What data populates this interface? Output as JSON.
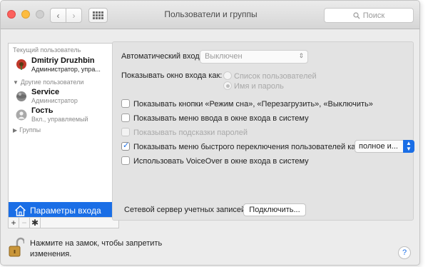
{
  "window": {
    "title": "Пользователи и группы",
    "search_placeholder": "Поиск"
  },
  "sidebar": {
    "current_user_header": "Текущий пользователь",
    "current_user": {
      "name": "Dmitriy Druzhbin",
      "role": "Администратор, упра..."
    },
    "other_users_header": "Другие пользователи",
    "other_users": [
      {
        "name": "Service",
        "role": "Администратор"
      },
      {
        "name": "Гость",
        "role": "Вкл., управляемый"
      }
    ],
    "groups_label": "Группы",
    "selected_item": "Параметры входа",
    "footer": {
      "add": "+",
      "remove": "−",
      "gear": "✱"
    }
  },
  "login_options": {
    "autologin_label": "Автоматический вход:",
    "autologin_value": "Выключен",
    "show_window_label": "Показывать окно входа как:",
    "radio_list": "Список пользователей",
    "radio_name_password": "Имя и пароль",
    "checkboxes": [
      {
        "label": "Показывать кнопки «Режим сна», «Перезагрузить», «Выключить»",
        "checked": false,
        "enabled": true
      },
      {
        "label": "Показывать меню ввода в окне входа в систему",
        "checked": false,
        "enabled": true
      },
      {
        "label": "Показывать подсказки паролей",
        "checked": false,
        "enabled": false
      },
      {
        "label": "Показывать меню быстрого переключения пользователей как:",
        "checked": true,
        "enabled": true
      },
      {
        "label": "Использовать VoiceOver в окне входа в систему",
        "checked": false,
        "enabled": true
      }
    ],
    "fast_switch_value": "полное и...",
    "network_server_label": "Сетевой сервер учетных записей:",
    "connect_button": "Подключить..."
  },
  "footer": {
    "lock_text_line1": "Нажмите на замок, чтобы запретить",
    "lock_text_line2": "изменения.",
    "help": "?"
  },
  "colors": {
    "accent": "#1a6ee6",
    "selection": "#1a6ee6"
  }
}
